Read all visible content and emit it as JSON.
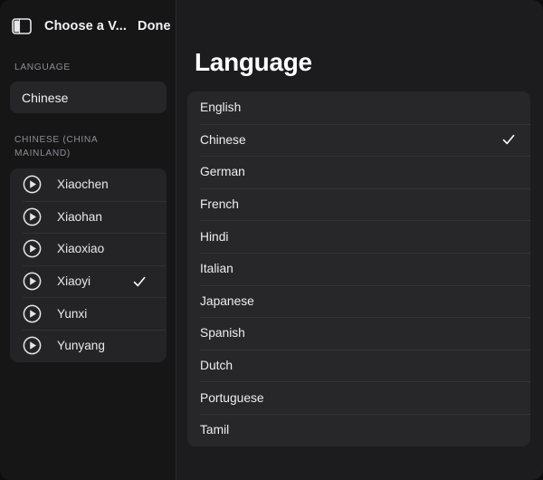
{
  "window": {
    "background": "#1c1c1e",
    "sidebar_background": "#161617",
    "accent_text": "#ffffff"
  },
  "toolbar": {
    "sidebar_toggle_icon": "sidebar-panel-icon",
    "title": "Choose a V...",
    "done_label": "Done"
  },
  "sidebar": {
    "language_section_label": "LANGUAGE",
    "language_field": {
      "value": "Chinese"
    },
    "voices_section_label": "CHINESE (CHINA MAINLAND)",
    "voices": [
      {
        "name": "Xiaochen",
        "play_icon": "play-circle-icon",
        "selected": false
      },
      {
        "name": "Xiaohan",
        "play_icon": "play-circle-icon",
        "selected": false
      },
      {
        "name": "Xiaoxiao",
        "play_icon": "play-circle-icon",
        "selected": false
      },
      {
        "name": "Xiaoyi",
        "play_icon": "play-circle-icon",
        "selected": true
      },
      {
        "name": "Yunxi",
        "play_icon": "play-circle-icon",
        "selected": false
      },
      {
        "name": "Yunyang",
        "play_icon": "play-circle-icon",
        "selected": false
      }
    ]
  },
  "main": {
    "title": "Language",
    "languages": [
      {
        "name": "English",
        "selected": false
      },
      {
        "name": "Chinese",
        "selected": true
      },
      {
        "name": "German",
        "selected": false
      },
      {
        "name": "French",
        "selected": false
      },
      {
        "name": "Hindi",
        "selected": false
      },
      {
        "name": "Italian",
        "selected": false
      },
      {
        "name": "Japanese",
        "selected": false
      },
      {
        "name": "Spanish",
        "selected": false
      },
      {
        "name": "Dutch",
        "selected": false
      },
      {
        "name": "Portuguese",
        "selected": false
      },
      {
        "name": "Tamil",
        "selected": false
      }
    ],
    "check_icon": "checkmark-icon"
  }
}
